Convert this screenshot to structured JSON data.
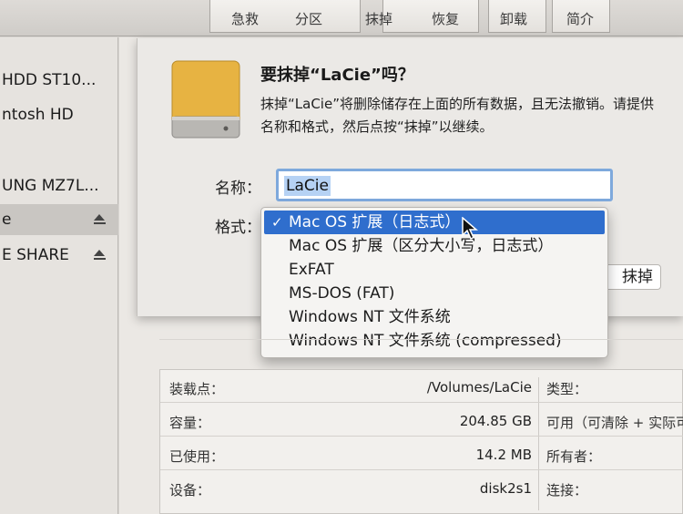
{
  "toolbar": {
    "buttons": [
      "急救",
      "分区",
      "抹掉",
      "恢复",
      "卸载",
      "简介"
    ]
  },
  "sidebar": {
    "items": [
      {
        "label": "HDD ST10...",
        "selected": false,
        "eject": false
      },
      {
        "label": "ntosh HD",
        "selected": false,
        "eject": false
      },
      {
        "label": "UNG MZ7L...",
        "selected": false,
        "eject": false
      },
      {
        "label": "e",
        "selected": true,
        "eject": true
      },
      {
        "label": "E SHARE",
        "selected": false,
        "eject": true
      }
    ]
  },
  "sheet": {
    "title": "要抹掉“LaCie”吗？",
    "description": "抹掉“LaCie”将删除储存在上面的所有数据，且无法撤销。请提供名称和格式，然后点按“抹掉”以继续。",
    "name_label": "名称：",
    "name_value": "LaCie",
    "format_label": "格式：",
    "erase_button": "抹掉"
  },
  "format_menu": {
    "checkmark": "✓",
    "options": [
      "Mac OS 扩展（日志式）",
      "Mac OS 扩展（区分大小写，日志式）",
      "ExFAT",
      "MS-DOS (FAT)",
      "Windows NT 文件系统",
      "Windows NT 文件系统 (compressed)"
    ],
    "selected_index": 0
  },
  "info": {
    "rows": [
      {
        "key": "装载点：",
        "value": "/Volumes/LaCie",
        "right_key": "类型："
      },
      {
        "key": "容量：",
        "value": "204.85 GB",
        "right_key": "可用（可清除 + 实际可"
      },
      {
        "key": "已使用：",
        "value": "14.2 MB",
        "right_key": "所有者："
      },
      {
        "key": "设备：",
        "value": "disk2s1",
        "right_key": "连接："
      }
    ]
  },
  "colors": {
    "selection_blue": "#2f6ecd",
    "focus_ring": "#7ea9dc",
    "disk_icon": "#e9b53f"
  }
}
